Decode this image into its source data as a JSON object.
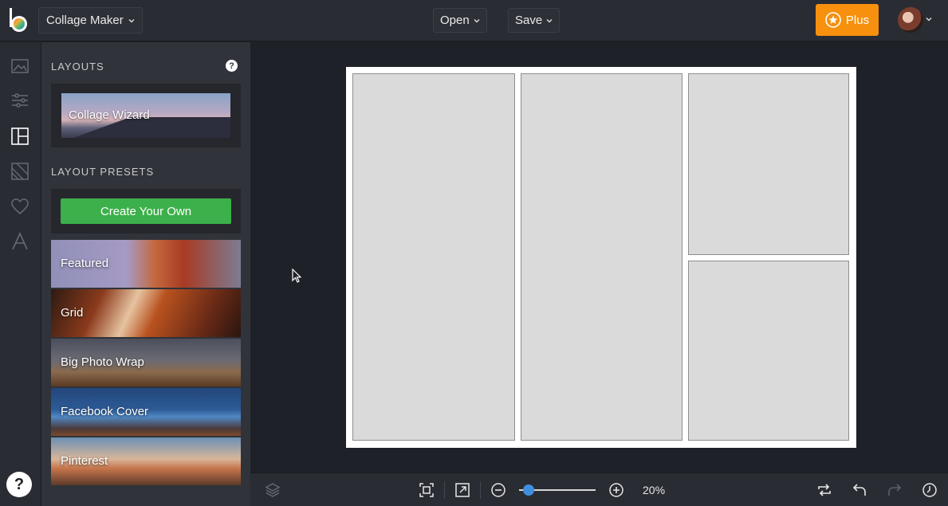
{
  "topbar": {
    "app_mode": "Collage Maker",
    "open_label": "Open",
    "save_label": "Save",
    "plus_label": "Plus",
    "accent_color": "#f7900d"
  },
  "rail": {
    "icons": [
      "image-icon",
      "adjustments-icon",
      "layouts-icon",
      "texture-icon",
      "heart-icon",
      "text-icon"
    ],
    "help_label": "?"
  },
  "panel": {
    "layouts_title": "LAYOUTS",
    "layouts_help": "?",
    "wizard_label": "Collage Wizard",
    "presets_title": "LAYOUT PRESETS",
    "create_label": "Create Your Own",
    "create_color": "#3cb04a",
    "presets": [
      {
        "label": "Featured"
      },
      {
        "label": "Grid"
      },
      {
        "label": "Big Photo Wrap"
      },
      {
        "label": "Facebook Cover"
      },
      {
        "label": "Pinterest"
      }
    ]
  },
  "canvas": {
    "cells": 4
  },
  "bottombar": {
    "zoom_value": "20%",
    "zoom_level": 0.05
  }
}
